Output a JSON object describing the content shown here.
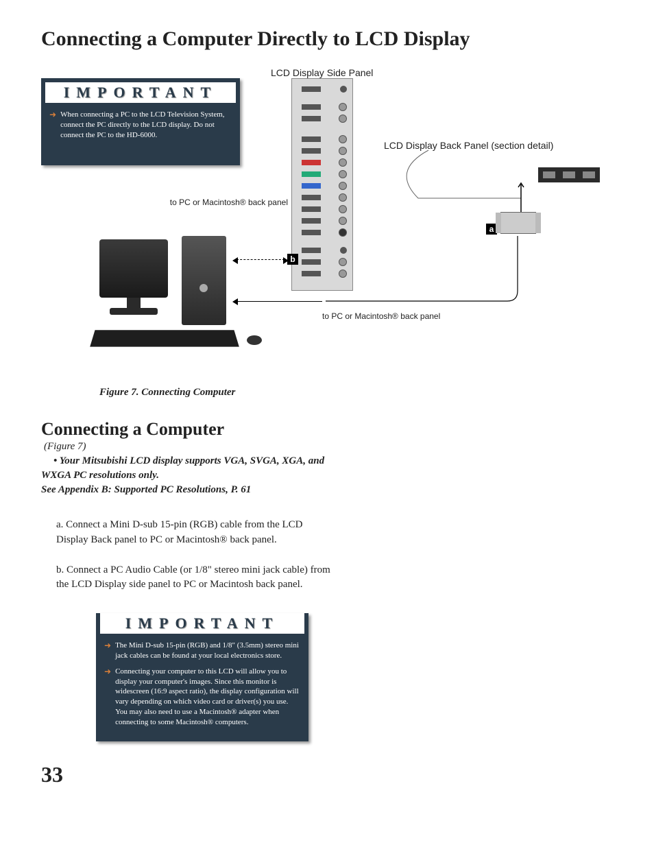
{
  "page_title": "Connecting a Computer Directly to LCD Display",
  "figure": {
    "label_side_panel": "LCD Display Side Panel",
    "label_back_panel": "LCD Display Back Panel (section detail)",
    "label_to_pc_1": "to PC or Macintosh® back panel",
    "label_to_pc_2": "to PC or Macintosh® back panel",
    "marker_a": "a",
    "marker_b": "b",
    "caption": "Figure 7.  Connecting Computer"
  },
  "important_top": {
    "header": "IMPORTANT",
    "item1": "When connecting a PC to the LCD Television System, connect the PC directly to the LCD display. Do not connect the PC to the HD-6000."
  },
  "section": {
    "title": "Connecting a Computer",
    "ref": "(Figure 7)",
    "note_bullet": "• Your Mitsubishi LCD display supports VGA, SVGA, XGA, and WXGA PC resolutions only.",
    "note_line2": "See Appendix B: Supported PC Resolutions, P. 61",
    "step_a": "a.  Connect a Mini D-sub 15-pin (RGB) cable from the LCD Display Back panel to PC or Macintosh® back panel.",
    "step_b": "b.  Connect a PC Audio Cable (or 1/8\" stereo mini jack cable) from the LCD Display side panel to PC or Macintosh back panel."
  },
  "important_bottom": {
    "header": "IMPORTANT",
    "item1": "The Mini D-sub 15-pin (RGB) and 1/8\" (3.5mm) stereo mini jack cables can be found at your local electronics store.",
    "item2": "Connecting your computer to this LCD  will allow you to display your computer's images. Since this monitor is widescreen (16:9 aspect ratio), the display configuration will vary depending on which video card or driver(s) you use.  You may also need to use a Macintosh® adapter when connecting to some Macintosh® computers."
  },
  "page_number": "33"
}
